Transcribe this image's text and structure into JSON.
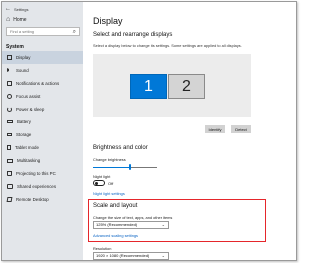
{
  "window": {
    "title": "Settings"
  },
  "sidebar": {
    "home_label": "Home",
    "search_placeholder": "Find a setting",
    "section_heading": "System",
    "items": [
      {
        "label": "Display",
        "icon": "display-icon",
        "active": true
      },
      {
        "label": "Sound",
        "icon": "speaker-icon"
      },
      {
        "label": "Notifications & actions",
        "icon": "notifications-icon"
      },
      {
        "label": "Focus assist",
        "icon": "moon-icon"
      },
      {
        "label": "Power & sleep",
        "icon": "power-icon"
      },
      {
        "label": "Battery",
        "icon": "battery-icon"
      },
      {
        "label": "Storage",
        "icon": "storage-icon"
      },
      {
        "label": "Tablet mode",
        "icon": "tablet-icon"
      },
      {
        "label": "Multitasking",
        "icon": "multitasking-icon"
      },
      {
        "label": "Projecting to this PC",
        "icon": "projector-icon"
      },
      {
        "label": "Shared experiences",
        "icon": "shared-icon"
      },
      {
        "label": "Remote Desktop",
        "icon": "remote-desktop-icon"
      }
    ]
  },
  "main": {
    "title": "Display",
    "arrange": {
      "heading": "Select and rearrange displays",
      "description": "Select a display below to change its settings. Some settings are applied to all displays.",
      "monitors": [
        "1",
        "2"
      ],
      "identify_label": "Identify",
      "detect_label": "Detect"
    },
    "brightness": {
      "heading": "Brightness and color",
      "brightness_label": "Change brightness",
      "brightness_level": 0.58,
      "night_light_label": "Night light",
      "night_light_state": "Off",
      "night_light_link": "Night light settings"
    },
    "scale": {
      "heading": "Scale and layout",
      "change_label": "Change the size of text, apps, and other items",
      "scale_value": "125% (Recommended)",
      "advanced_link": "Advanced scaling settings"
    },
    "resolution": {
      "label": "Resolution",
      "value": "1920 × 1080 (Recommended)"
    }
  },
  "colors": {
    "accent": "#0078d7",
    "highlight_box": "#e5262b",
    "sidebar_bg": "#e3e6ea"
  }
}
